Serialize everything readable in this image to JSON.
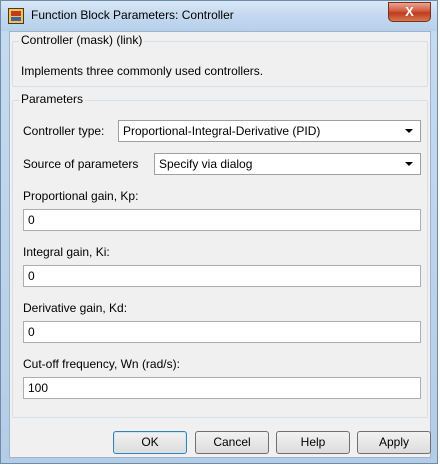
{
  "window": {
    "title": "Function Block Parameters: Controller",
    "close_glyph": "X",
    "app_icon": "simulink-block-icon"
  },
  "description": {
    "group_title": "Controller (mask) (link)",
    "text": "Implements three commonly used controllers."
  },
  "parameters": {
    "group_title": "Parameters",
    "controller_type": {
      "label": "Controller type:",
      "value": "Proportional-Integral-Derivative (PID)"
    },
    "source": {
      "label": "Source of parameters",
      "value": "Specify via dialog"
    },
    "kp": {
      "label": "Proportional gain, Kp:",
      "value": "0"
    },
    "ki": {
      "label": "Integral gain, Ki:",
      "value": "0"
    },
    "kd": {
      "label": "Derivative gain, Kd:",
      "value": "0"
    },
    "wn": {
      "label": "Cut-off frequency, Wn (rad/s):",
      "value": "100"
    }
  },
  "buttons": {
    "ok": "OK",
    "cancel": "Cancel",
    "help": "Help",
    "apply": "Apply"
  }
}
